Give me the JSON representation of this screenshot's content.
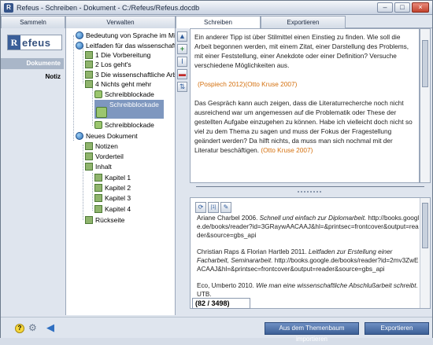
{
  "window": {
    "title": "Refeus - Schreiben - Dokument - C:/Refeus/Refeus.docdb",
    "minimize": "–",
    "maximize": "□",
    "close": "×"
  },
  "tabs": [
    {
      "label": "Sammeln"
    },
    {
      "label": "Verwalten"
    },
    {
      "label": "Schreiben"
    },
    {
      "label": "Exportieren"
    }
  ],
  "sidebar": {
    "logo_mark": "R",
    "logo_text": "efeus",
    "items": [
      {
        "label": "Dokumente"
      },
      {
        "label": "Notiz"
      }
    ]
  },
  "tree": {
    "items": [
      {
        "label": "Bedeutung von Sprache im Migra"
      },
      {
        "label": "Leitfaden für das wissenschaftlic"
      },
      {
        "label": "1 Die Vorbereitung"
      },
      {
        "label": "2 Los geht's"
      },
      {
        "label": "3 Die wissenschaftliche Arbe"
      },
      {
        "label": "4 Nichts geht mehr"
      },
      {
        "label": "Schreibblockade"
      },
      {
        "label": "Schreibblockade"
      },
      {
        "label": "Schreibblockade"
      },
      {
        "label": "Neues Dokument"
      },
      {
        "label": "Notizen"
      },
      {
        "label": "Vorderteil"
      },
      {
        "label": "Inhalt"
      },
      {
        "label": "Kapitel 1"
      },
      {
        "label": "Kapitel 2"
      },
      {
        "label": "Kapitel 3"
      },
      {
        "label": "Kapitel 4"
      },
      {
        "label": "Rückseite"
      }
    ]
  },
  "toolstrip": {
    "collapse": "▲",
    "add": "+",
    "text_cursor": "I",
    "remove": "▬",
    "swap": "⇅"
  },
  "editor": {
    "p1": "Ein anderer Tipp ist über Stilmittel einen Einstieg zu finden. Wie soll die Arbeit begonnen werden, mit einem Zitat, einer Darstellung des Problems, mit einer Feststellung, einer Anekdote oder einer Definition? Versuche verschiedene Möglichkeiten aus.",
    "cite1": "(Pospiech 2012)(Otto Kruse 2007)",
    "p2": "Das Gespräch kann auch zeigen, dass die Literaturrecherche noch nicht ausreichend war um angemessen auf die Problematik oder These der gestellten Aufgabe einzugehen zu können. Habe ich vielleicht doch nicht so viel zu dem Thema zu sagen und muss der Fokus der Fragestellung geändert werden? Da hilft nichts, da muss man sich nochmal mit der Literatur beschäftigen.",
    "cite2": "(Otto Kruse 2007)"
  },
  "refs": {
    "tool_refresh": "⟳",
    "tool_cite": "[1]",
    "tool_edit": "✎",
    "items": [
      {
        "author": "Ariane Charbel 2006. ",
        "title": "Schnell und einfach zur Diplomarbeit.",
        "url": " http://books.google.de/books/reader?id=3GRaywAACAAJ&hl=&printsec=frontcover&output=reader&source=gbs_api"
      },
      {
        "author": "Christian Raps & Florian Hartleb 2011. ",
        "title": "Leitfaden zur Erstellung einer Facharbeit, Seminararbeit.",
        "url": " http://books.google.de/books/reader?id=2mv3ZwEACAAJ&hl=&printsec=frontcover&output=reader&source=gbs_api"
      },
      {
        "author": "Eco, Umberto 2010. ",
        "title": "Wie man eine wissenschaftliche Abschlußarbeit schreibt.",
        "url": " UTB."
      }
    ],
    "counter": "(82 / 3498)"
  },
  "bottom": {
    "help": "?",
    "gear": "⚙",
    "back": "◀",
    "import_button": "Aus dem Themenbaum importieren",
    "export_button": "Exportieren"
  }
}
